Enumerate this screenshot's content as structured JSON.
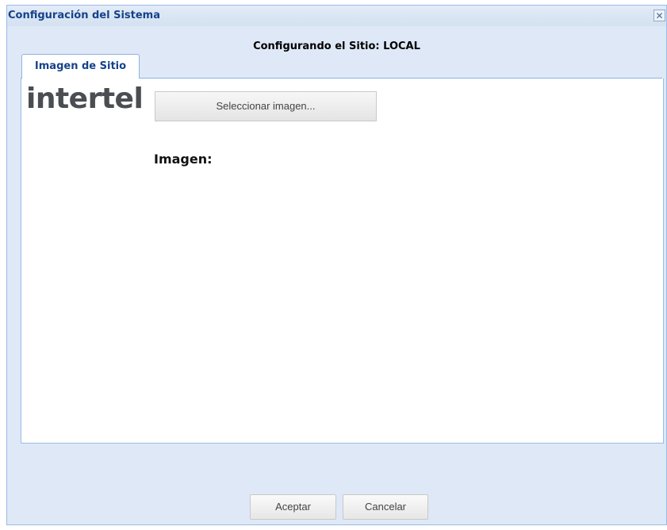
{
  "window": {
    "title": "Configuración del Sistema",
    "close_glyph": "✕",
    "subtitle": "Configurando el Sitio: LOCAL"
  },
  "tabs": [
    {
      "label": "Imagen de Sitio",
      "active": true
    }
  ],
  "panel": {
    "logo_text": "intertel",
    "select_button_label": "Seleccionar imagen...",
    "image_label": "Imagen:"
  },
  "footer": {
    "accept_label": "Aceptar",
    "cancel_label": "Cancelar"
  },
  "colors": {
    "title": "#15428b",
    "window_bg": "#dfe8f6",
    "border": "#99bbe8",
    "logo": "#4a4d52"
  },
  "icons": {
    "close": "close-icon"
  }
}
